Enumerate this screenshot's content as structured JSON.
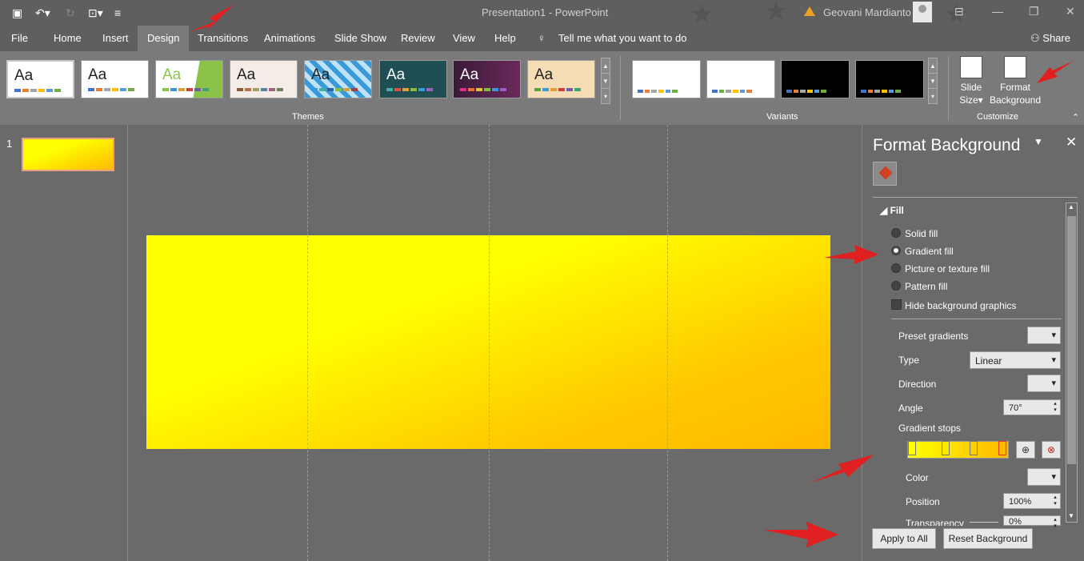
{
  "window": {
    "title": "Presentation1  -  PowerPoint",
    "user": "Geovani Mardianto"
  },
  "quick_access": {
    "save_icon": "save-icon",
    "undo_icon": "undo-icon",
    "redo_icon": "redo-icon",
    "start_icon": "start-presentation-icon",
    "more_icon": "more-icon"
  },
  "window_buttons": {
    "ribbon_display": "ribbon-display-icon",
    "minimize": "minimize-icon",
    "restore": "restore-icon",
    "close": "close-icon"
  },
  "tabs": [
    {
      "label": "File"
    },
    {
      "label": "Home"
    },
    {
      "label": "Insert"
    },
    {
      "label": "Design"
    },
    {
      "label": "Transitions"
    },
    {
      "label": "Animations"
    },
    {
      "label": "Slide Show"
    },
    {
      "label": "Review"
    },
    {
      "label": "View"
    },
    {
      "label": "Help"
    }
  ],
  "tellme": "Tell me what you want to do",
  "share": "Share",
  "ribbon": {
    "themes_label": "Themes",
    "variants_label": "Variants",
    "customize_label": "Customize",
    "themes": [
      {
        "aa": "Aa",
        "bg": "#ffffff"
      },
      {
        "aa": "Aa",
        "bg": "#ffffff"
      },
      {
        "aa": "Aa",
        "bg": "#ffffff"
      },
      {
        "aa": "Aa",
        "bg": "#f4ece6"
      },
      {
        "aa": "Aa",
        "bg": "#d8eef8"
      },
      {
        "aa": "Aa",
        "bg": "#1f4f55"
      },
      {
        "aa": "Aa",
        "bg": "#4a2a4a"
      },
      {
        "aa": "Aa",
        "bg": "#f4dcb4"
      }
    ],
    "variants": [
      {
        "bg": "#ffffff"
      },
      {
        "bg": "#ffffff"
      },
      {
        "bg": "#000000"
      },
      {
        "bg": "#000000"
      }
    ],
    "slide_size": "Slide\nSize",
    "slide_size_l1": "Slide",
    "slide_size_l2": "Size",
    "format_bg_l1": "Format",
    "format_bg_l2": "Background"
  },
  "slides": {
    "count": "1"
  },
  "pane": {
    "title": "Format Background",
    "section": "Fill",
    "fill_options": {
      "solid": "Solid fill",
      "gradient": "Gradient fill",
      "picture": "Picture or texture fill",
      "pattern": "Pattern fill"
    },
    "hide_graphics": "Hide background graphics",
    "preset_label": "Preset gradients",
    "type_label": "Type",
    "type_value": "Linear",
    "direction_label": "Direction",
    "angle_label": "Angle",
    "angle_value": "70°",
    "stops_label": "Gradient stops",
    "color_label": "Color",
    "position_label": "Position",
    "position_value": "100%",
    "transparency_label": "Transparency",
    "transparency_value": "0%",
    "apply_all": "Apply to All",
    "reset": "Reset Background"
  },
  "colors": {
    "accent": "#d83b01",
    "slide_top": "#ffff00",
    "slide_bottom": "#ffb800"
  }
}
